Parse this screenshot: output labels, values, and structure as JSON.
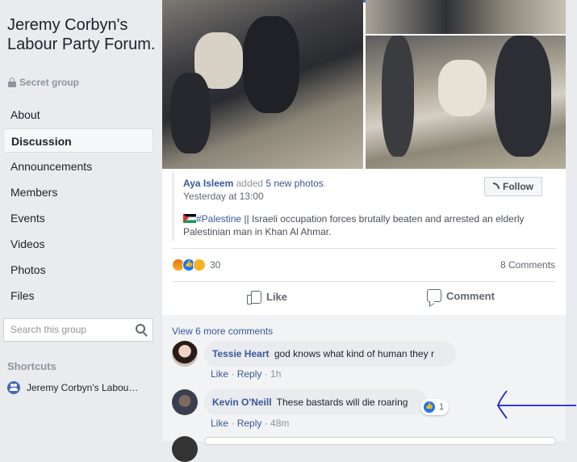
{
  "sidebar": {
    "title": "Jeremy Corbyn's Labour Party Forum.",
    "privacy": "Secret group",
    "nav": [
      "About",
      "Discussion",
      "Announcements",
      "Members",
      "Events",
      "Videos",
      "Photos",
      "Files"
    ],
    "active_index": 1,
    "search_placeholder": "Search this group",
    "shortcuts_heading": "Shortcuts",
    "shortcut_item": "Jeremy Corbyn's Labou…"
  },
  "post": {
    "shared_by": "Aya Isleem",
    "shared_action": " added ",
    "shared_count": "5 new photos",
    "timestamp": "Yesterday at 13:00",
    "follow_label": "Follow",
    "hashtag": "#Palestine",
    "text": " || Israeli occupation forces brutally beaten and arrested an elderly Palestinian man in Khan Al Ahmar.",
    "reaction_count": "30",
    "comments_count": "8 Comments",
    "like_label": "Like",
    "comment_label": "Comment"
  },
  "comments": {
    "more_label": "View 6 more comments",
    "items": [
      {
        "author": "Tessie Heart",
        "text": "god knows what kind of human they r",
        "like": "Like",
        "reply": "Reply",
        "time": "1h"
      },
      {
        "author": "Kevin O'Neill",
        "text": "These bastards will die roaring",
        "like": "Like",
        "reply": "Reply",
        "time": "48m",
        "reaction_count": "1"
      }
    ]
  },
  "colors": {
    "link": "#365899",
    "annotation_arrow": "#1a23c9"
  }
}
